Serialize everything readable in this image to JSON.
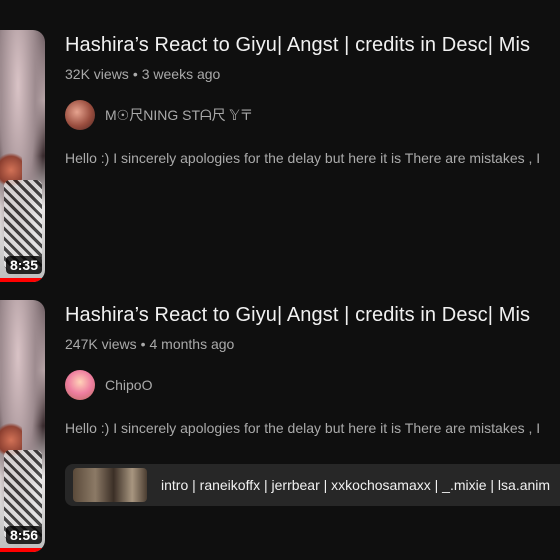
{
  "results": [
    {
      "title": "Hashira’s React to Giyu| Angst | credits in Desc| Mis",
      "views": "32K views",
      "age": "3 weeks ago",
      "channel": "M☉尺NING STᗩ尺 𝕐〒",
      "description": "Hello :) I sincerely apologies for the delay but here it is There are mistakes , I",
      "duration": "8:35",
      "watched_fraction": 1.0
    },
    {
      "title": "Hashira’s React to Giyu| Angst | credits in Desc| Mis",
      "views": "247K views",
      "age": "4 months ago",
      "channel": "ChipoO",
      "description": "Hello :) I sincerely apologies for the delay but here it is There are mistakes , I",
      "duration": "8:56",
      "watched_fraction": 1.0,
      "chapters_text": "intro | raneikoffx | jerrbear | xxkochosamaxx | _.mixie | lsa.anim"
    }
  ],
  "separator": "•"
}
